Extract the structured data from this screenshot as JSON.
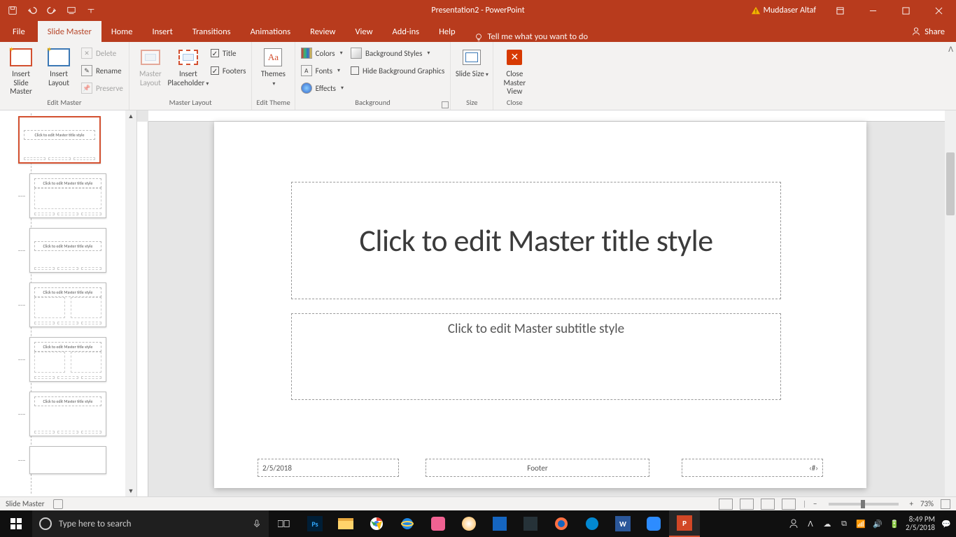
{
  "titlebar": {
    "doc": "Presentation2",
    "app": "PowerPoint",
    "user": "Muddaser Altaf"
  },
  "tabs": {
    "file": "File",
    "slide_master": "Slide Master",
    "home": "Home",
    "insert": "Insert",
    "transitions": "Transitions",
    "animations": "Animations",
    "review": "Review",
    "view": "View",
    "addins": "Add-ins",
    "help": "Help",
    "tellme": "Tell me what you want to do",
    "share": "Share"
  },
  "ribbon": {
    "edit_master": {
      "insert_slide_master": "Insert Slide Master",
      "insert_layout": "Insert Layout",
      "delete": "Delete",
      "rename": "Rename",
      "preserve": "Preserve",
      "label": "Edit Master"
    },
    "master_layout": {
      "master_layout": "Master Layout",
      "insert_placeholder": "Insert Placeholder",
      "title": "Title",
      "footers": "Footers",
      "label": "Master Layout"
    },
    "edit_theme": {
      "themes": "Themes",
      "label": "Edit Theme"
    },
    "background": {
      "colors": "Colors",
      "fonts": "Fonts",
      "effects": "Effects",
      "bg_styles": "Background Styles",
      "hide_bg": "Hide Background Graphics",
      "label": "Background"
    },
    "size": {
      "slide_size": "Slide Size",
      "label": "Size"
    },
    "close": {
      "close_master": "Close Master View",
      "label": "Close"
    }
  },
  "slide": {
    "title_ph": "Click to edit Master title style",
    "subtitle_ph": "Click to edit Master subtitle style",
    "date": "2/5/2018",
    "footer": "Footer",
    "slidenum": "‹#›"
  },
  "thumb": {
    "mini_title": "Click to edit Master title style"
  },
  "status": {
    "mode": "Slide Master",
    "zoom": "73%",
    "minus": "−",
    "plus": "+"
  },
  "taskbar": {
    "search_ph": "Type here to search",
    "time": "8:49 PM",
    "date": "2/5/2018"
  }
}
